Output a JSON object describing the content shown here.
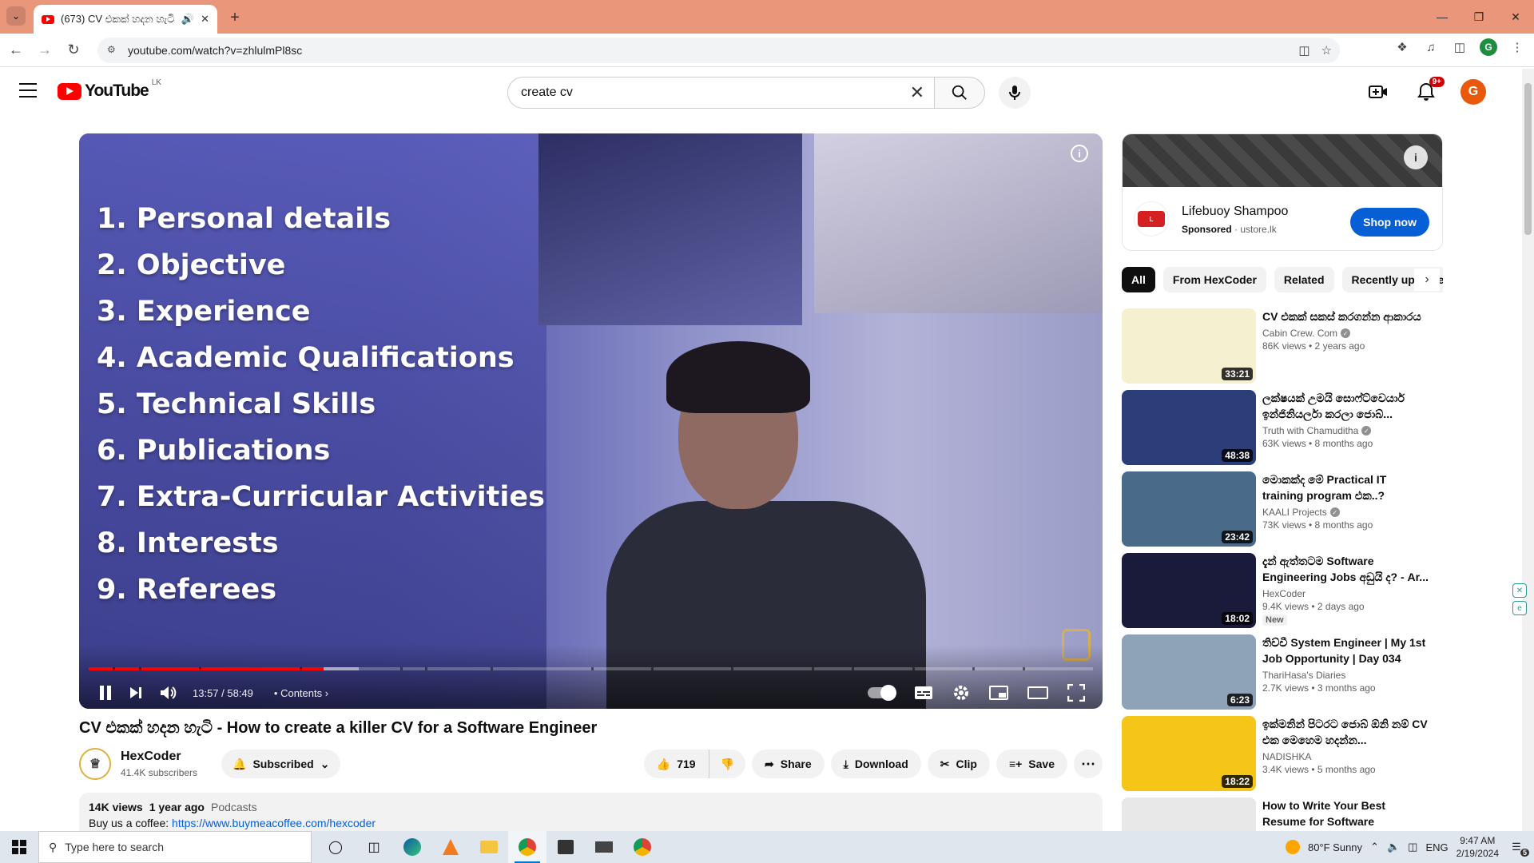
{
  "browser": {
    "tab_title": "(673) CV එකක් හදන හැටි",
    "url": "youtube.com/watch?v=zhlulmPl8sc"
  },
  "youtube": {
    "logo_text": "YouTube",
    "country_code": "LK",
    "search_value": "create cv",
    "notification_count": "9+",
    "avatar_letter": "G"
  },
  "player": {
    "overlay_lines": [
      "1. Personal details",
      "2. Objective",
      "3. Experience",
      "4. Academic Qualifications",
      "5. Technical Skills",
      "6. Publications",
      "7. Extra-Curricular Activities",
      "8. Interests",
      "9. Referees"
    ],
    "time": "13:57 / 58:49",
    "contents_label": "Contents",
    "progress_played": 0.234,
    "progress_loaded": 0.269
  },
  "video": {
    "title": "CV එකක් හදන හැටි - How to create a killer CV for a Software Engineer",
    "channel_name": "HexCoder",
    "subscribers": "41.4K subscribers",
    "subscribed_label": "Subscribed",
    "likes": "719",
    "share_label": "Share",
    "download_label": "Download",
    "clip_label": "Clip",
    "save_label": "Save",
    "views": "14K views",
    "age": "1 year ago",
    "category": "Podcasts",
    "coffee_prefix": "Buy us a coffee:",
    "coffee_link": "https://www.buymeacoffee.com/hexcoder"
  },
  "ad": {
    "title": "Lifebuoy Shampoo",
    "sponsored": "Sponsored",
    "domain": "ustore.lk",
    "cta": "Shop now"
  },
  "chips": [
    "All",
    "From HexCoder",
    "Related",
    "Recently uploaded"
  ],
  "recommendations": [
    {
      "title": "CV එකක් සකස් කරගන්න ආකාරය",
      "channel": "Cabin Crew. Com",
      "views": "86K views • 2 years ago",
      "duration": "33:21",
      "new": "",
      "verified": true,
      "color": "#f4f0d0"
    },
    {
      "title": "ලක්ෂයක් උමයි සොෆ්ට්වෙයාර් ඉන්ජිනියර්ලා කරලා ජොබ්...",
      "channel": "Truth with Chamuditha",
      "views": "63K views • 8 months ago",
      "duration": "48:38",
      "new": "",
      "verified": true,
      "color": "#2c3e7a"
    },
    {
      "title": "මොකක්ද මේ Practical IT training program එක..?",
      "channel": "KAALI Projects",
      "views": "73K views • 8 months ago",
      "duration": "23:42",
      "new": "",
      "verified": true,
      "color": "#4a6a8a"
    },
    {
      "title": "දැන් ඇත්තටම Software Engineering Jobs අඩුයි ද? - Ar...",
      "channel": "HexCoder",
      "views": "9.4K views • 2 days ago",
      "duration": "18:02",
      "new": "New",
      "verified": false,
      "color": "#1a1a3a"
    },
    {
      "title": "තිච්චී System Engineer | My 1st Job Opportunity | Day 034",
      "channel": "ThariHasa's Diaries",
      "views": "2.7K views • 3 months ago",
      "duration": "6:23",
      "new": "",
      "verified": false,
      "color": "#8fa3b8"
    },
    {
      "title": "ඉක්මනින් පිටරට ජොබ් ඕනි නම් CV එක මෙහෙම හදන්න...",
      "channel": "NADISHKA",
      "views": "3.4K views • 5 months ago",
      "duration": "18:22",
      "new": "",
      "verified": false,
      "color": "#f5c518"
    },
    {
      "title": "How to Write Your Best Resume for Software Engineering Jobs...",
      "channel": "",
      "views": "",
      "duration": "",
      "new": "",
      "verified": false,
      "color": "#e8e8e8"
    }
  ],
  "taskbar": {
    "search_placeholder": "Type here to search",
    "weather": "80°F  Sunny",
    "lang": "ENG",
    "time": "9:47 AM",
    "date": "2/19/2024",
    "notif_count": "5"
  }
}
